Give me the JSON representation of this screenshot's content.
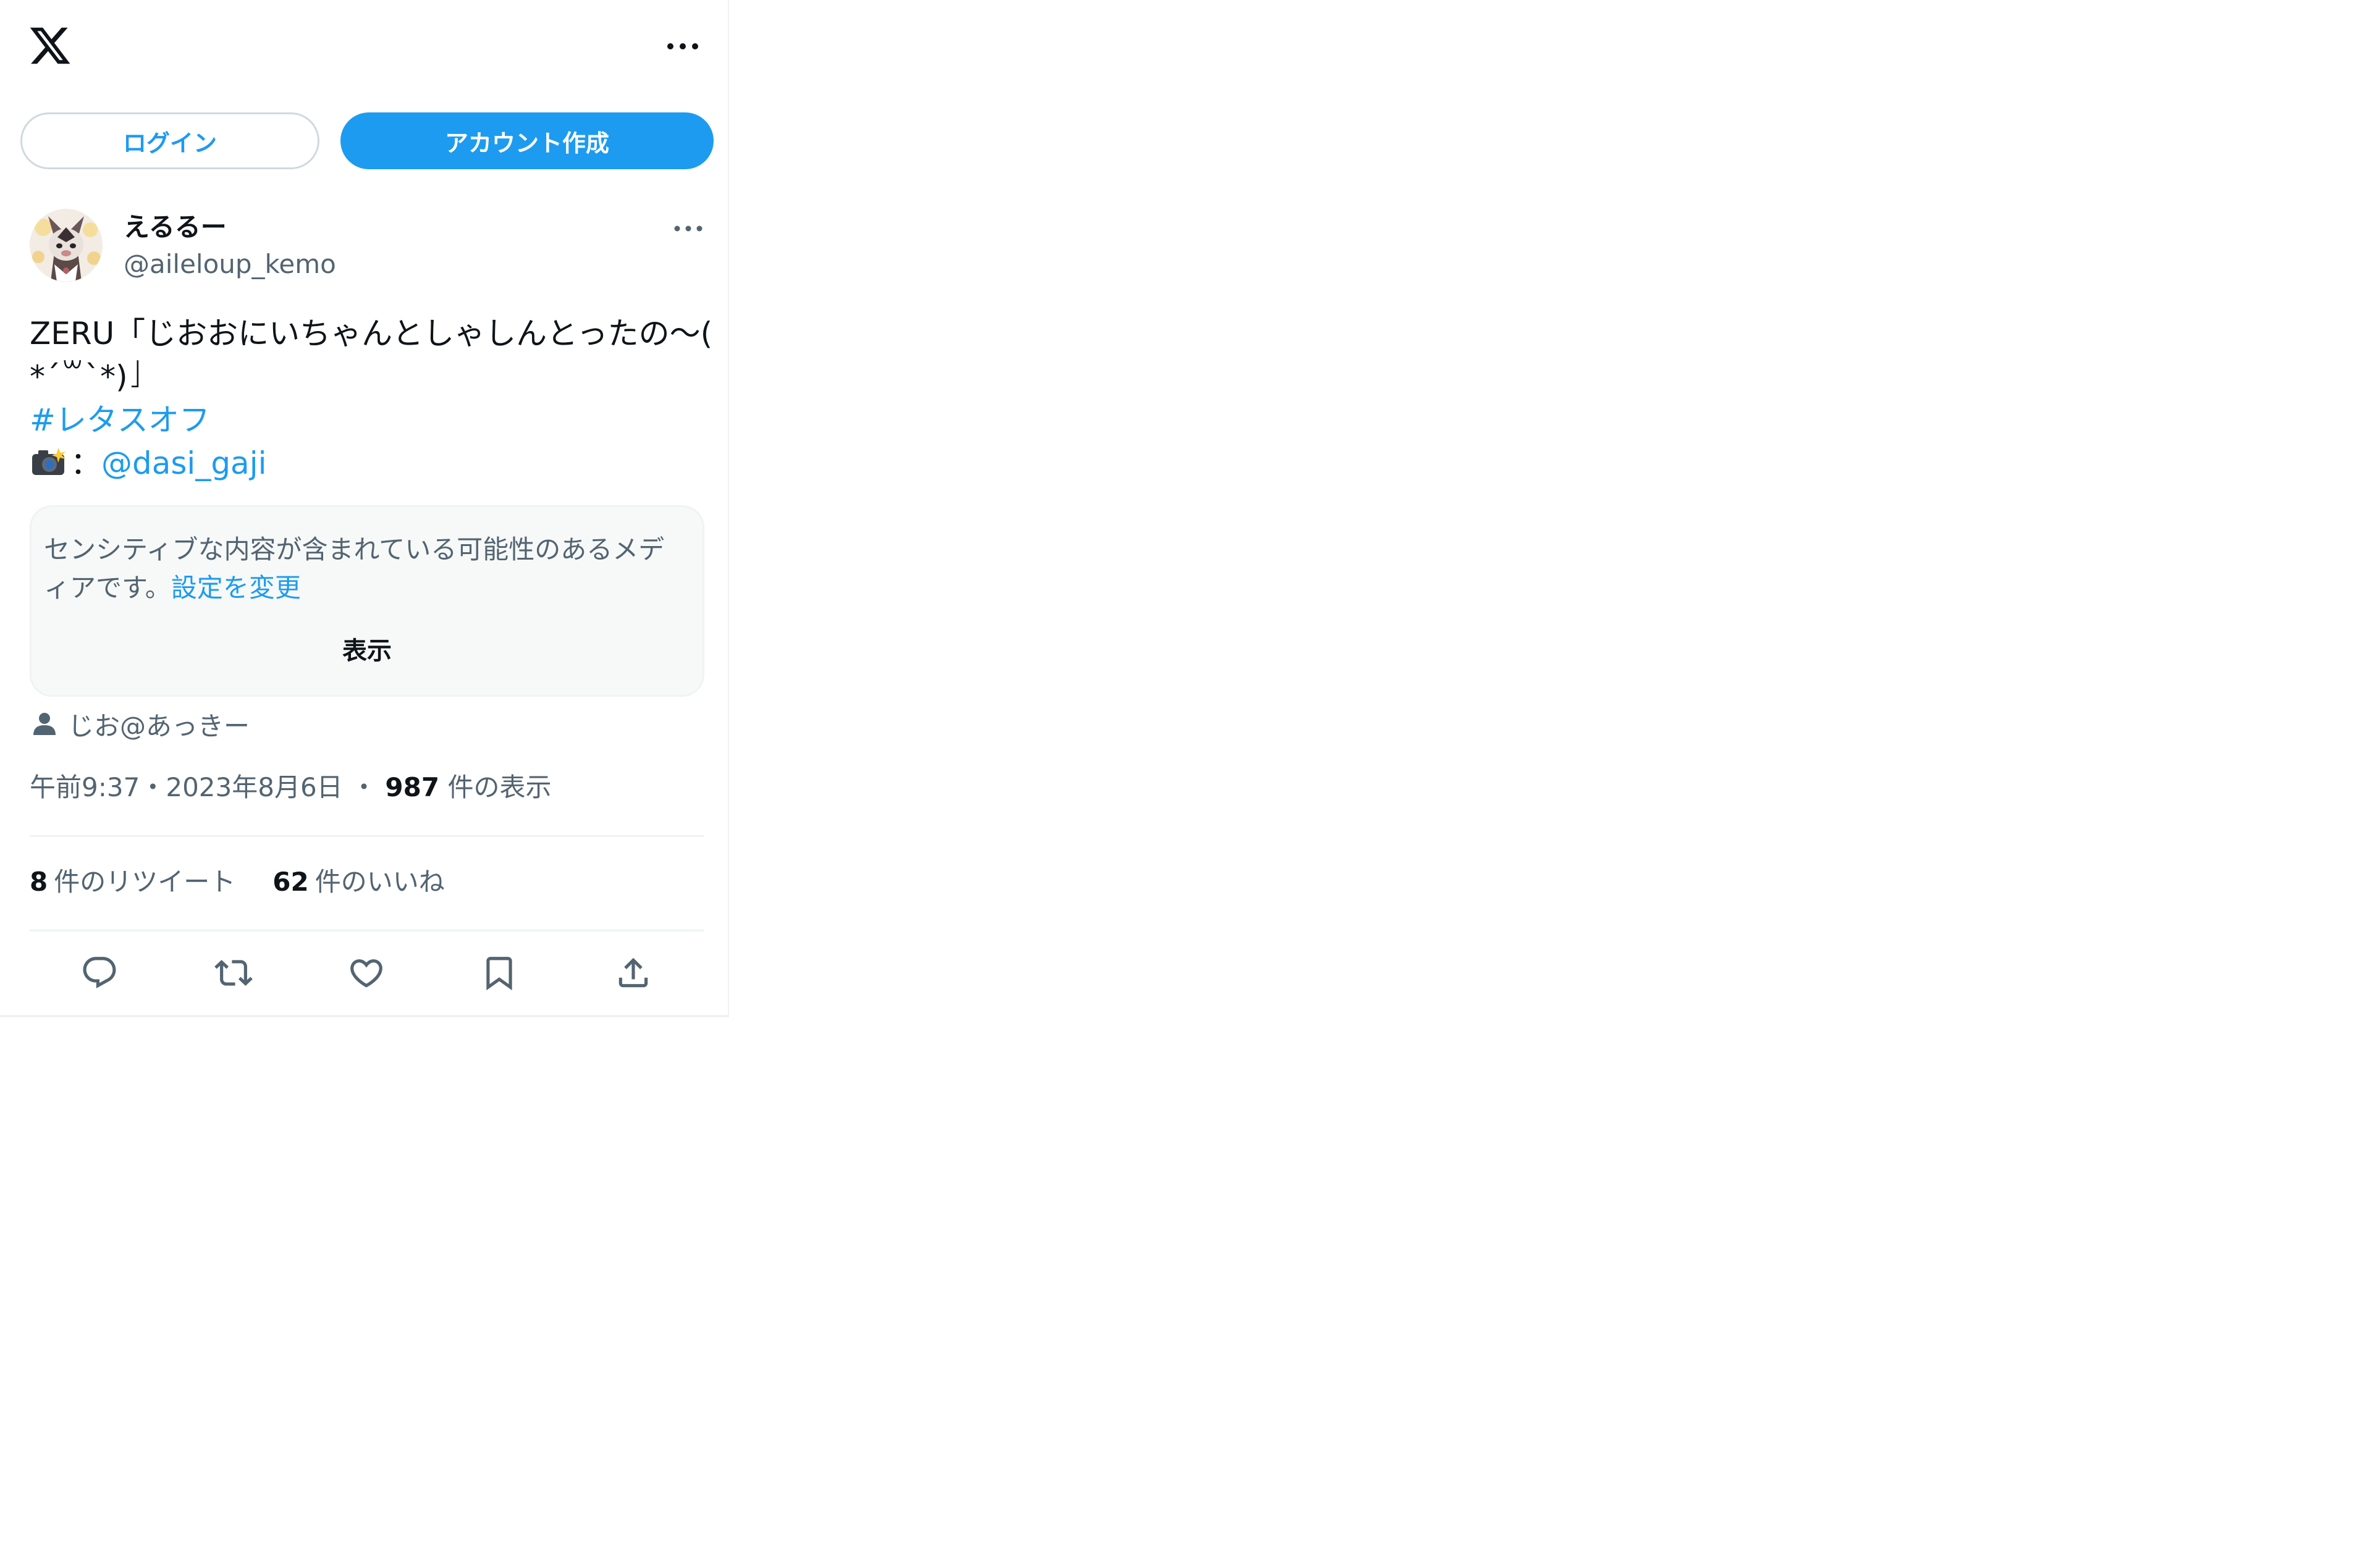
{
  "header": {
    "logo_icon": "x-logo-icon",
    "more_icon": "more-horizontal-icon"
  },
  "auth": {
    "login_label": "ログイン",
    "signup_label": "アカウント作成"
  },
  "tweet": {
    "author": {
      "display_name": "えるるー",
      "handle": "@aileloup_kemo"
    },
    "text_line1": "ZERU「じおおにいちゃんとしゃしんとったの〜(",
    "text_line2": "*´꒳`*)」",
    "hashtag": "#レタスオフ",
    "camera_separator": "：",
    "mention": "@dasi_gaji",
    "sensitive": {
      "message_line1": "センシティブな内容が含まれている可能性のあるメデ",
      "message_line2_prefix": "ィアです。",
      "settings_link": "設定を変更",
      "show_label": "表示"
    },
    "tagged_user": "じお@あっきー",
    "time": "午前9:37",
    "date": "2023年8月6日",
    "separator": "・",
    "views_count": "987",
    "views_label": "件の表示",
    "retweets_count": "8",
    "retweets_label": "件のリツイート",
    "likes_count": "62",
    "likes_label": "件のいいね"
  },
  "actions": [
    {
      "icon": "reply-icon"
    },
    {
      "icon": "retweet-icon"
    },
    {
      "icon": "like-heart-icon"
    },
    {
      "icon": "bookmark-icon"
    },
    {
      "icon": "share-icon"
    }
  ],
  "colors": {
    "accent": "#1d9bf0",
    "text_primary": "#0f1419",
    "text_secondary": "#536471",
    "border": "#eff3f4",
    "sensitive_bg": "#f7f9f9"
  }
}
